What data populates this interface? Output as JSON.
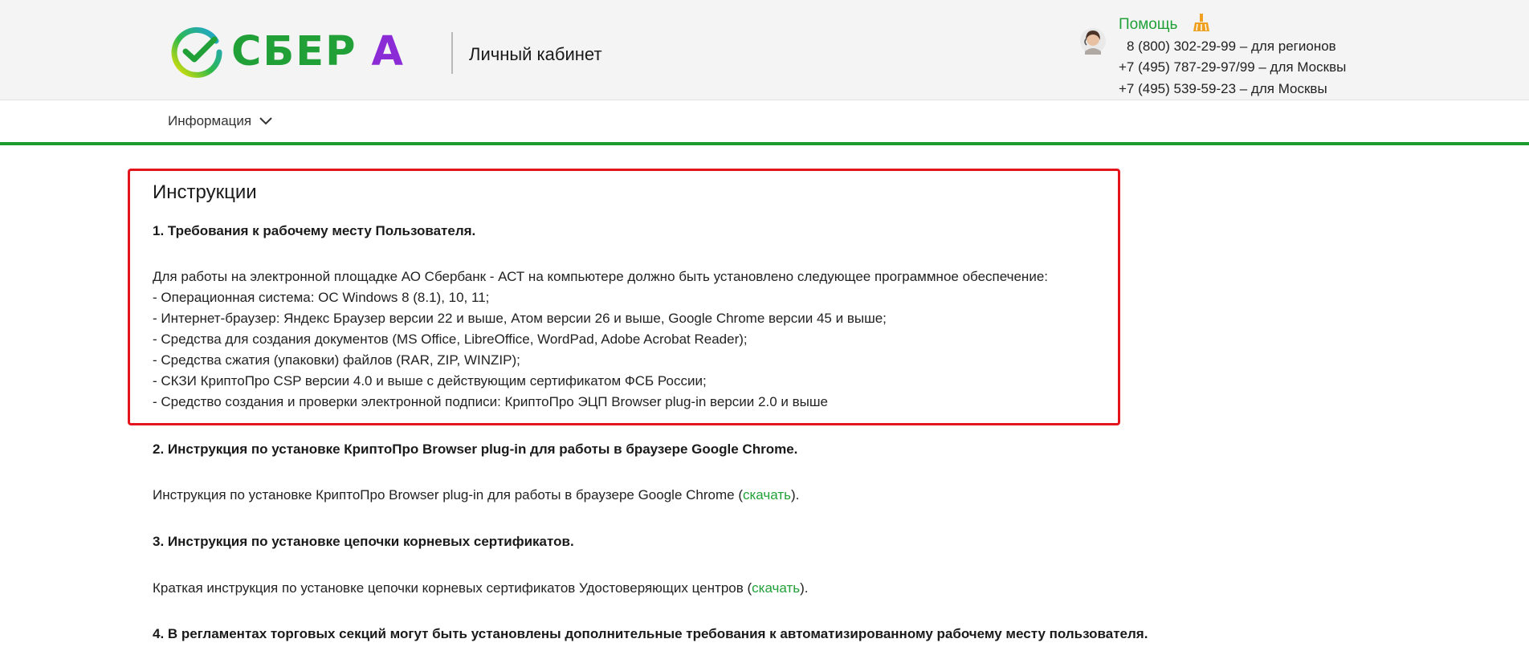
{
  "header": {
    "logo_text": "СБЕР",
    "logo_suffix": "А",
    "cabinet_label": "Личный кабинет",
    "help_label": "Помощь",
    "phones": [
      "8 (800) 302-29-99 – для регионов",
      "+7 (495) 787-29-97/99 – для Москвы",
      "+7 (495) 539-59-23 – для Москвы"
    ]
  },
  "nav": {
    "info_label": "Информация"
  },
  "main": {
    "title": "Инструкции",
    "section1": {
      "heading": "1. Требования к рабочему месту Пользователя.",
      "intro": "Для работы на электронной площадке АО Сбербанк - АСТ на компьютере должно быть установлено следующее программное обеспечение:",
      "items": [
        "- Операционная система: ОС Windows 8 (8.1), 10, 11;",
        "- Интернет-браузер: Яндекс Браузер версии 22 и выше, Атом версии 26 и выше, Google Chrome версии 45 и выше;",
        "- Средства для создания документов (MS Office, LibreOffice, WordPad, Adobe Acrobat Reader);",
        "- Средства сжатия (упаковки) файлов (RAR, ZIP, WINZIP);",
        "- СКЗИ КриптоПро CSP версии 4.0 и выше с действующим сертификатом ФСБ России;",
        "- Средство создания и проверки электронной подписи: КриптоПро ЭЦП Browser plug-in версии 2.0 и выше"
      ]
    },
    "section2": {
      "heading": "2. Инструкция по установке КриптоПро Browser plug-in для работы в браузере Google Chrome.",
      "text_before": "Инструкция по установке КриптоПро Browser plug-in для работы в браузере Google Chrome (",
      "link": "скачать",
      "text_after": ")."
    },
    "section3": {
      "heading": "3. Инструкция по установке цепочки корневых сертификатов.",
      "text_before": "Краткая инструкция по установке цепочки корневых сертификатов Удостоверяющих центров (",
      "link": "скачать",
      "text_after": ")."
    },
    "section4": {
      "heading": "4. В регламентах торговых секций могут быть установлены дополнительные требования к автоматизированному рабочему месту пользователя."
    }
  },
  "colors": {
    "brand_green": "#21a038",
    "accent_purple": "#8b2bd6",
    "highlight_red": "#e3141c",
    "nav_border": "#1e9b2e"
  }
}
